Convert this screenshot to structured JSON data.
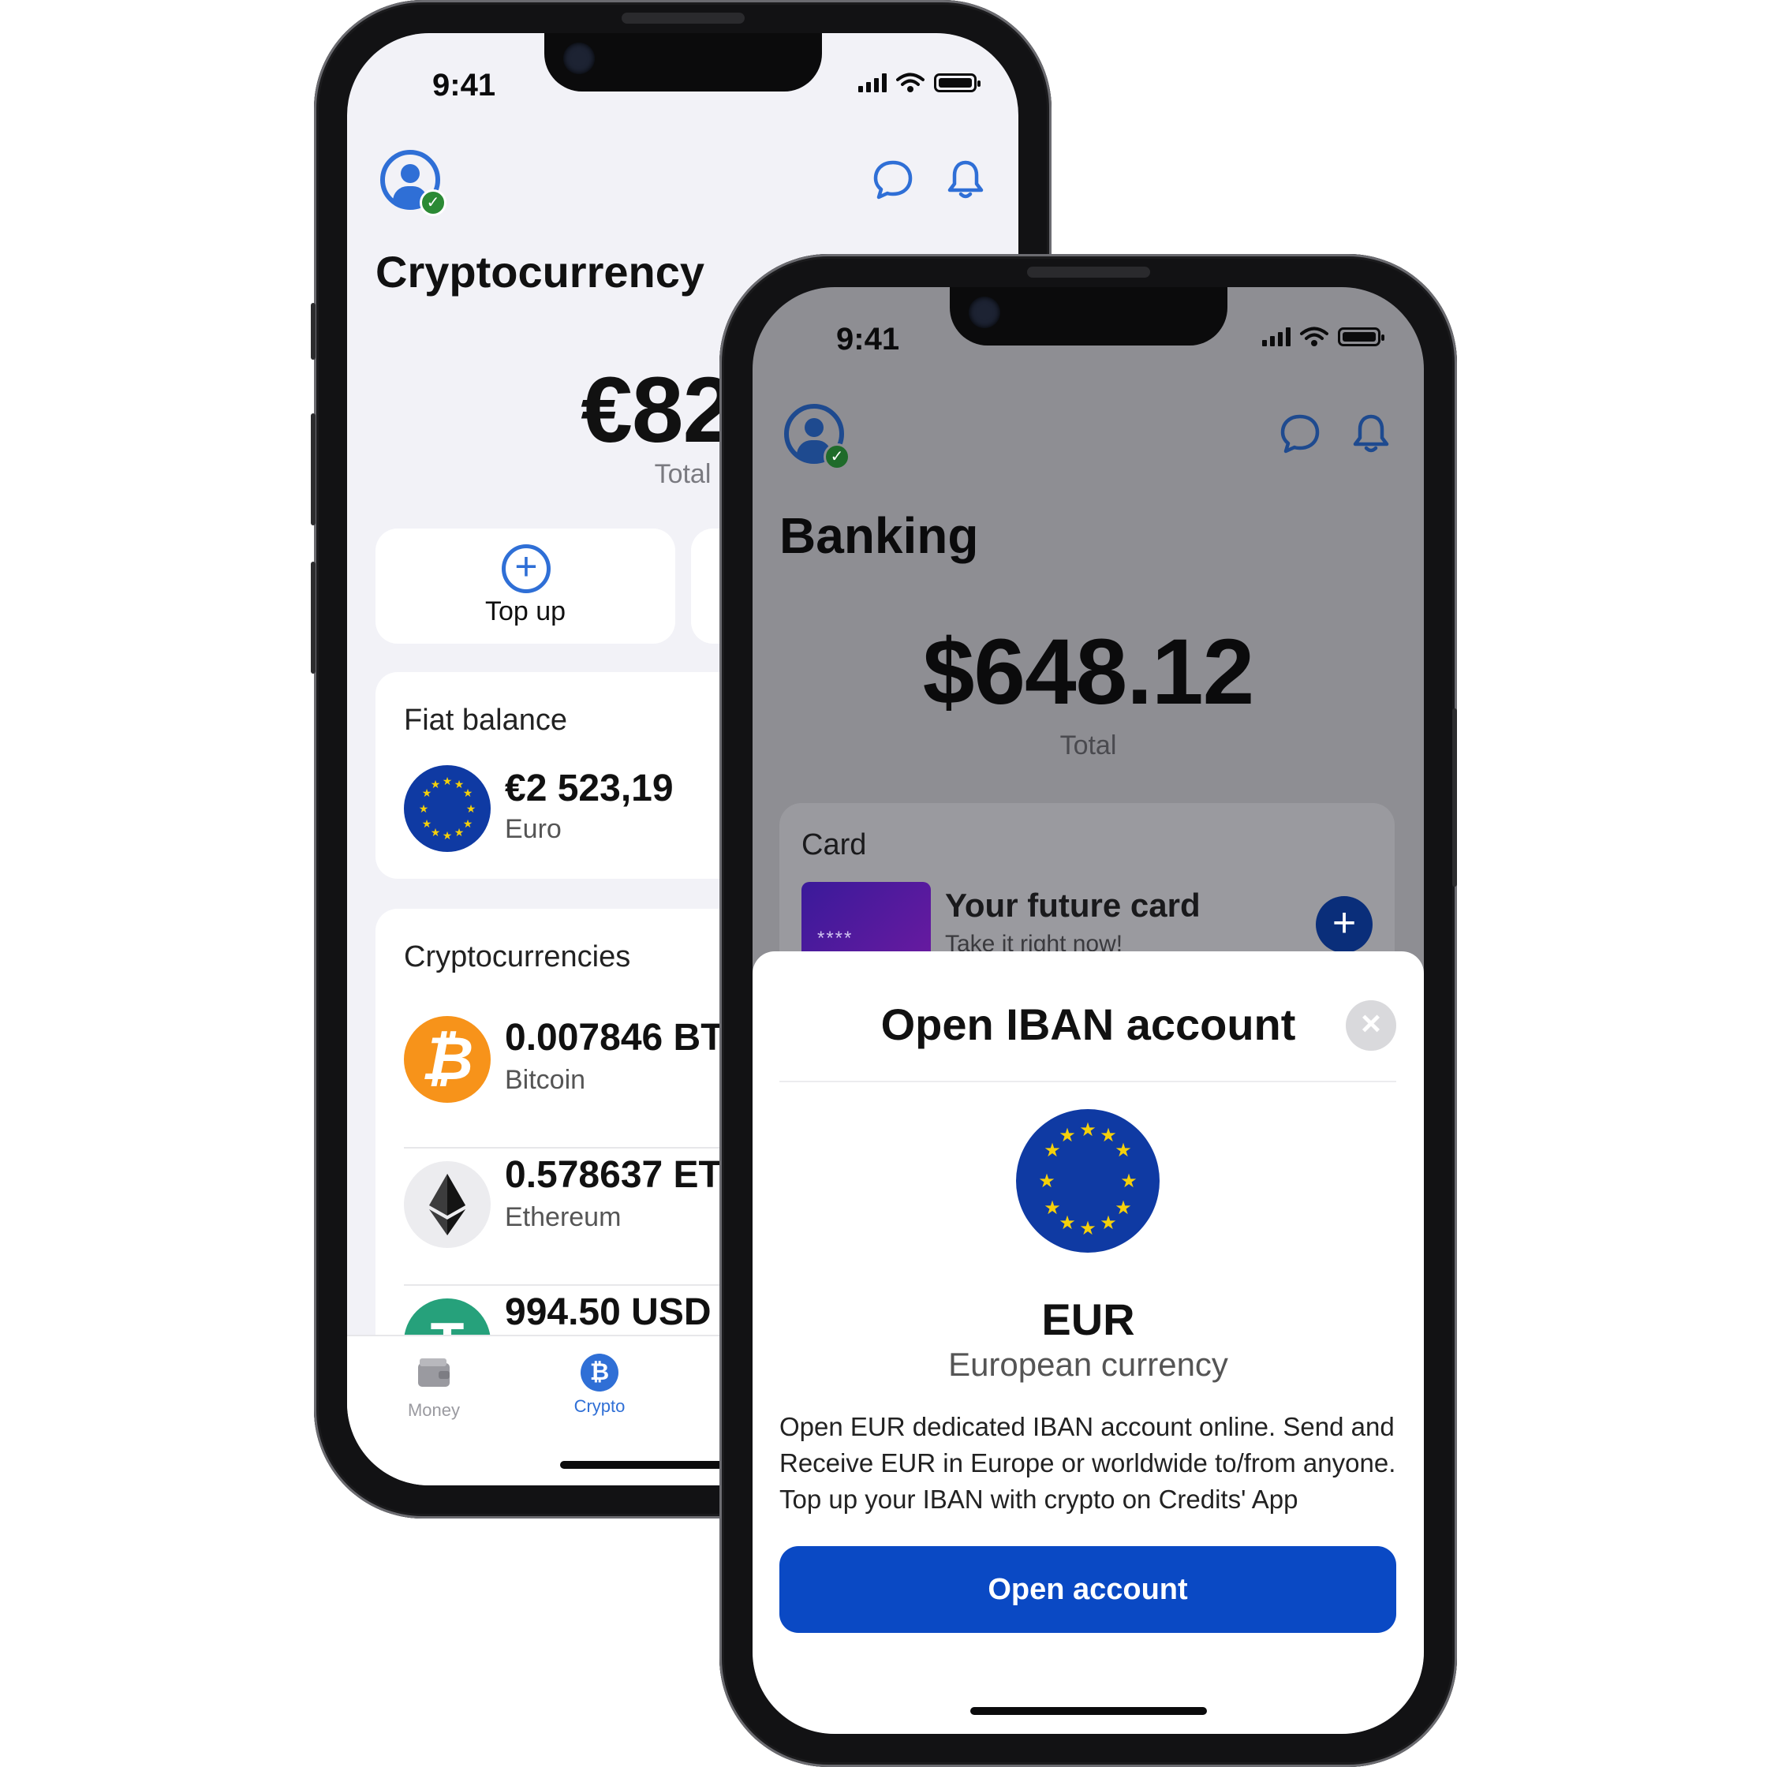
{
  "colors": {
    "accent": "#2f6fd6",
    "primary_button": "#0a49c4",
    "bitcoin": "#f7931a",
    "tether": "#26a17b",
    "eu_blue": "#0f3aa3",
    "eu_gold": "#f5d00a",
    "verified": "#2b8a35"
  },
  "crypto_screen": {
    "status": {
      "time": "9:41"
    },
    "header": {
      "avatar_icon": "user-avatar-icon",
      "chat_icon": "chat-bubble-icon",
      "bell_icon": "bell-icon"
    },
    "title": "Cryptocurrency",
    "amount": "€825",
    "total_label": "Total",
    "actions": [
      {
        "icon": "plus-circle-icon",
        "label": "Top up"
      }
    ],
    "fiat": {
      "title": "Fiat balance",
      "amount": "€2 523,19",
      "name": "Euro",
      "icon": "eu-flag-icon"
    },
    "cryptos": {
      "title": "Cryptocurrencies",
      "items": [
        {
          "amount": "0.007846 BT",
          "name": "Bitcoin",
          "icon": "bitcoin-icon"
        },
        {
          "amount": "0.578637 ET",
          "name": "Ethereum",
          "icon": "ethereum-icon"
        },
        {
          "amount": "994.50 USD",
          "name": "",
          "icon": "tether-icon"
        }
      ]
    },
    "tabs": [
      {
        "label": "Money",
        "icon": "wallet-icon"
      },
      {
        "label": "Crypto",
        "icon": "bitcoin-tab-icon"
      }
    ]
  },
  "banking_screen": {
    "status": {
      "time": "9:41"
    },
    "title": "Banking",
    "amount": "$648.12",
    "total_label": "Total",
    "card": {
      "title": "Card",
      "masked": "****",
      "future_title": "Your future card",
      "future_sub": "Take it right now!"
    },
    "sheet": {
      "title": "Open IBAN account",
      "code": "EUR",
      "currency": "European currency",
      "description": "Open EUR dedicated IBAN account online. Send and Receive EUR in Europe or worldwide to/from anyone. Top up your IBAN with crypto on Credits' App",
      "button": "Open account"
    }
  }
}
